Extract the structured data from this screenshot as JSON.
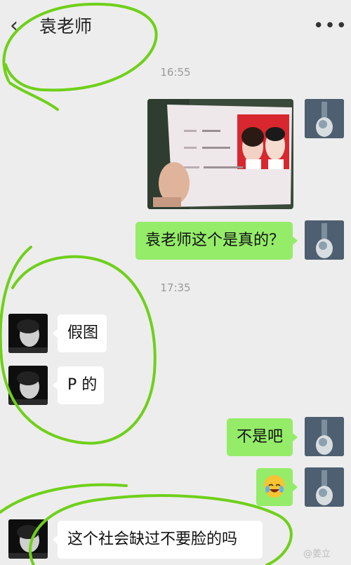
{
  "header": {
    "back_glyph": "‹",
    "title": "袁老师",
    "more_glyph": "•••"
  },
  "timestamps": [
    "16:55",
    "17:35"
  ],
  "messages": {
    "sent_question": "袁老师这个是真的？",
    "reply1": "假图",
    "reply2": "P 的",
    "sent_reply": "不是吧",
    "reply3": "这个社会缺过不要脸的吗"
  },
  "icons": {
    "emoji": "crying-laughing-emoji-icon",
    "back": "back-chevron-icon",
    "more": "more-dots-icon"
  },
  "colors": {
    "sent_bubble": "#95ec69",
    "received_bubble": "#ffffff",
    "background": "#ededed",
    "annotation": "#6fd01a"
  },
  "watermark": "@姜立"
}
